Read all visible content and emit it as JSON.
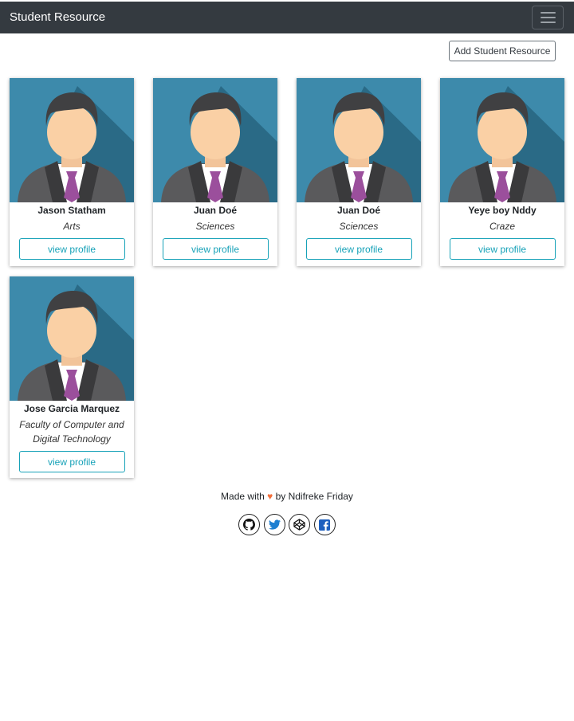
{
  "navbar": {
    "brand": "Student Resource",
    "toggler_icon": "hamburger-icon"
  },
  "actions": {
    "add_label": "Add Student Resource"
  },
  "students": [
    {
      "name": "Jason Statham",
      "department": "Arts",
      "button": "view profile"
    },
    {
      "name": "Juan Doé",
      "department": "Sciences",
      "button": "view profile"
    },
    {
      "name": "Juan Doé",
      "department": "Sciences",
      "button": "view profile"
    },
    {
      "name": "Yeye boy Nddy",
      "department": "Craze",
      "button": "view profile"
    },
    {
      "name": "Jose Garcia Marquez",
      "department": "Faculty of Computer and Digital Technology",
      "button": "view profile"
    }
  ],
  "footer": {
    "made_with": "Made with",
    "heart": "♥",
    "by": "by Ndifreke Friday",
    "social_icons": [
      "github-icon",
      "twitter-icon",
      "codepen-icon",
      "facebook-icon"
    ]
  },
  "colors": {
    "navbar_bg": "#343a40",
    "accent": "#17a2b8",
    "heart": "#f36f3b",
    "avatar_bg": "#3a87a8"
  }
}
